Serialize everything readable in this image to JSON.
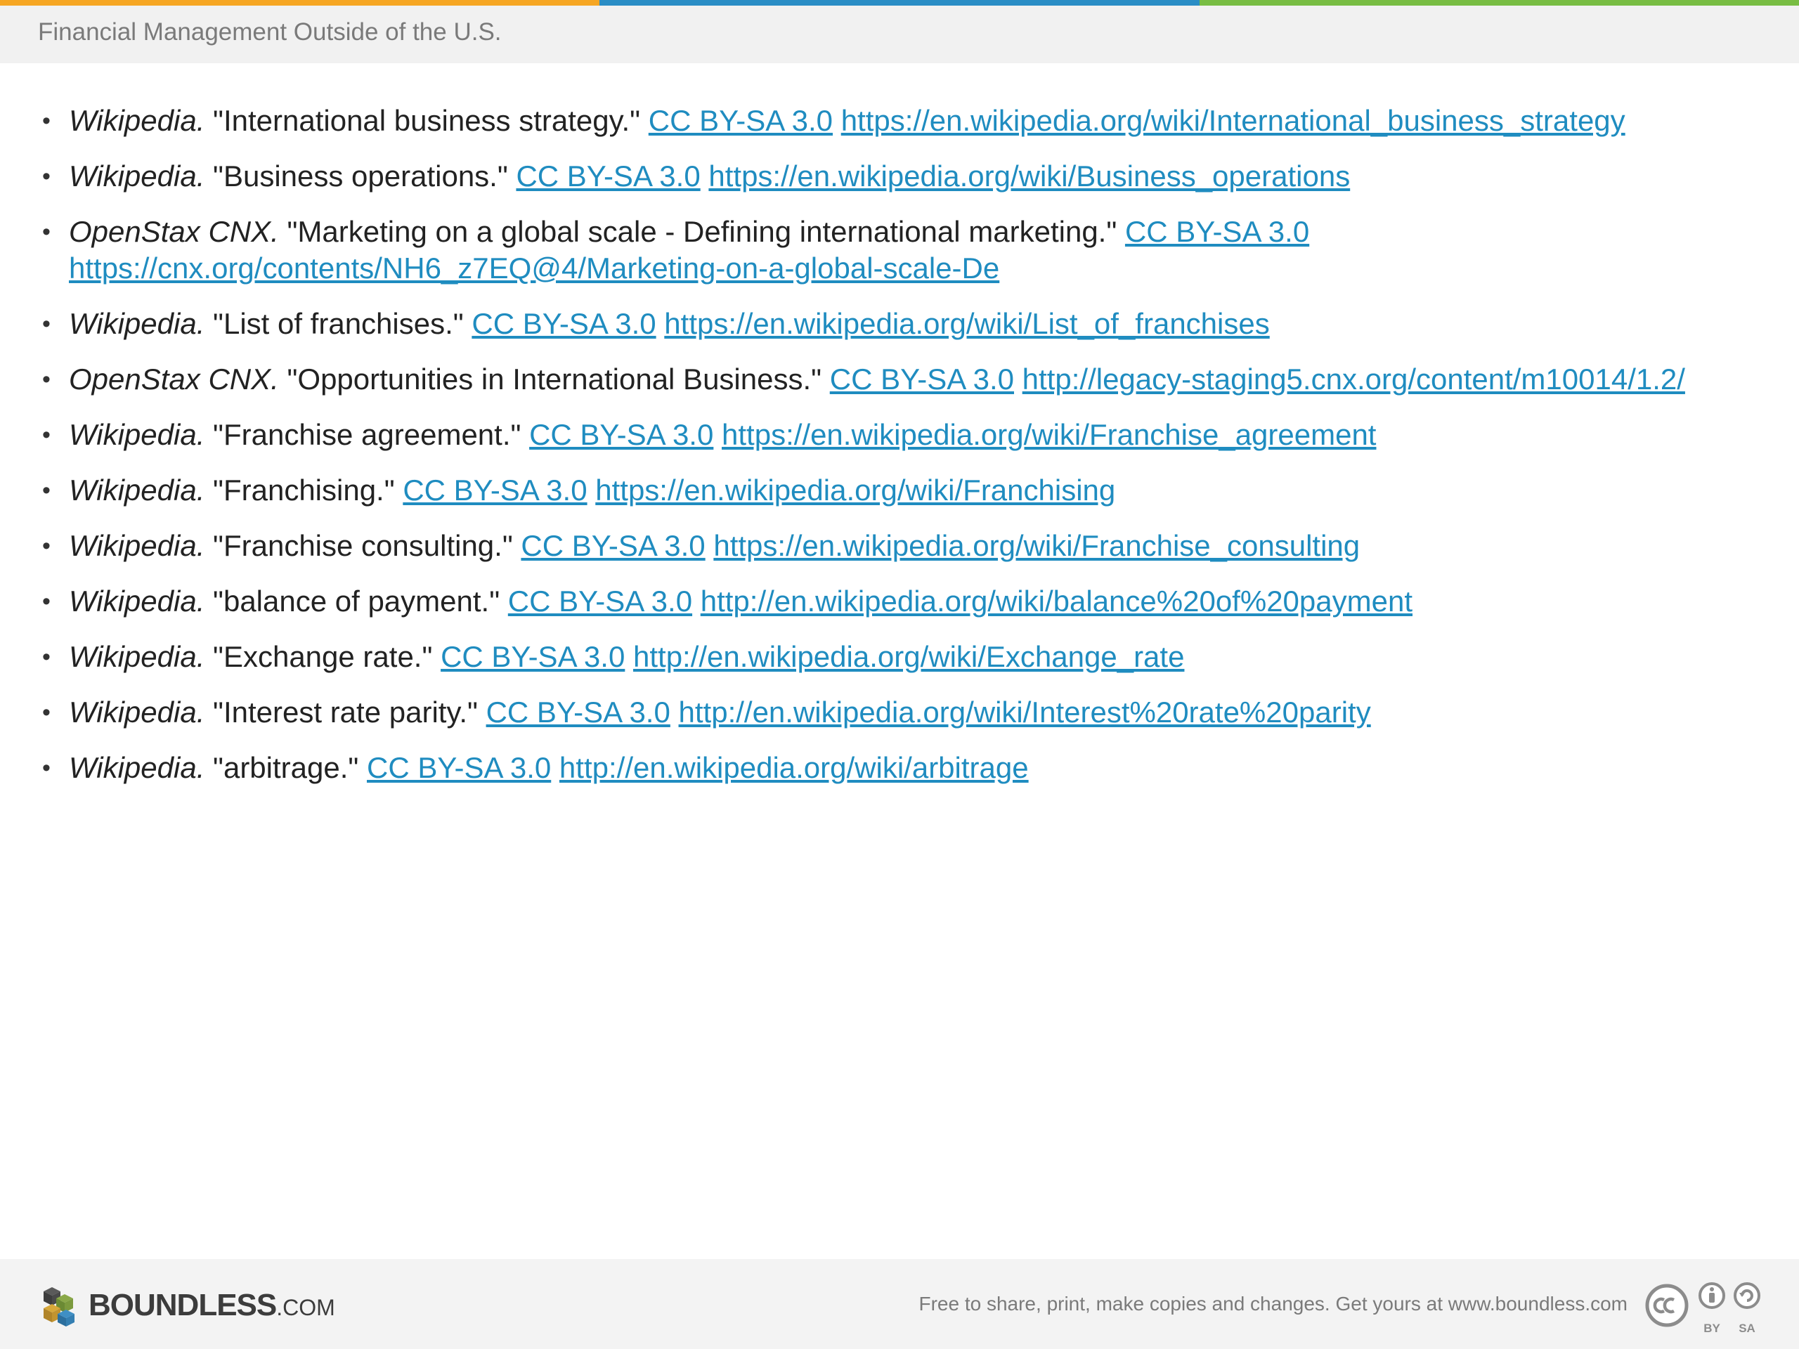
{
  "header": {
    "title": "Financial Management Outside of the U.S.",
    "stripe_colors": [
      "#f6a623",
      "#2a8dc5",
      "#78bd43"
    ]
  },
  "references": [
    {
      "source": "Wikipedia.",
      "title": "\"International business strategy.\"",
      "license": "CC BY-SA 3.0",
      "url": "https://en.wikipedia.org/wiki/International_business_strategy"
    },
    {
      "source": "Wikipedia.",
      "title": "\"Business operations.\"",
      "license": "CC BY-SA 3.0",
      "url": "https://en.wikipedia.org/wiki/Business_operations"
    },
    {
      "source": "OpenStax CNX.",
      "title": "\"Marketing on a global scale - Defining international marketing.\"",
      "license": "CC BY-SA 3.0",
      "url": "https://cnx.org/contents/NH6_z7EQ@4/Marketing-on-a-global-scale-De"
    },
    {
      "source": "Wikipedia.",
      "title": "\"List of franchises.\"",
      "license": "CC BY-SA 3.0",
      "url": "https://en.wikipedia.org/wiki/List_of_franchises"
    },
    {
      "source": "OpenStax CNX.",
      "title": "\"Opportunities in International Business.\"",
      "license": "CC BY-SA 3.0",
      "url": "http://legacy-staging5.cnx.org/content/m10014/1.2/"
    },
    {
      "source": "Wikipedia.",
      "title": "\"Franchise agreement.\"",
      "license": "CC BY-SA 3.0",
      "url": "https://en.wikipedia.org/wiki/Franchise_agreement"
    },
    {
      "source": "Wikipedia.",
      "title": "\"Franchising.\"",
      "license": "CC BY-SA 3.0",
      "url": "https://en.wikipedia.org/wiki/Franchising"
    },
    {
      "source": "Wikipedia.",
      "title": "\"Franchise consulting.\"",
      "license": "CC BY-SA 3.0",
      "url": "https://en.wikipedia.org/wiki/Franchise_consulting"
    },
    {
      "source": "Wikipedia.",
      "title": "\"balance of payment.\"",
      "license": "CC BY-SA 3.0",
      "url": "http://en.wikipedia.org/wiki/balance%20of%20payment"
    },
    {
      "source": "Wikipedia.",
      "title": "\"Exchange rate.\"",
      "license": "CC BY-SA 3.0",
      "url": "http://en.wikipedia.org/wiki/Exchange_rate"
    },
    {
      "source": "Wikipedia.",
      "title": "\"Interest rate parity.\"",
      "license": "CC BY-SA 3.0",
      "url": "http://en.wikipedia.org/wiki/Interest%20rate%20parity"
    },
    {
      "source": "Wikipedia.",
      "title": "\"arbitrage.\"",
      "license": "CC BY-SA 3.0",
      "url": "http://en.wikipedia.org/wiki/arbitrage"
    }
  ],
  "footer": {
    "logo_main": "BOUNDLESS",
    "logo_suffix": ".COM",
    "tagline": "Free to share, print, make copies and changes. Get yours at www.boundless.com",
    "cc_by_label": "BY",
    "cc_sa_label": "SA"
  },
  "link_color": "#1f8cc0"
}
